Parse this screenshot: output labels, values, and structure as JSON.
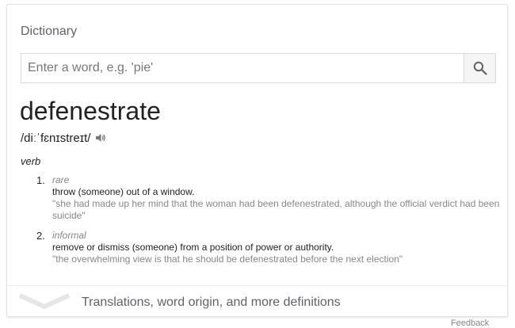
{
  "card": {
    "title": "Dictionary",
    "search": {
      "placeholder": "Enter a word, e.g. 'pie'"
    },
    "entry": {
      "word": "defenestrate",
      "pronunciation": "/diːˈfɛnɪstreɪt/",
      "part_of_speech": "verb",
      "senses": [
        {
          "number": "1.",
          "register": "rare",
          "definition": "throw (someone) out of a window.",
          "example": "\"she had made up her mind that the woman had been defenestrated, although the official verdict had been suicide\""
        },
        {
          "number": "2.",
          "register": "informal",
          "definition": "remove or dismiss (someone) from a position of power or authority.",
          "example": "\"the overwhelming view is that he should be defenestrated before the next election\""
        }
      ]
    },
    "more_link": "Translations, word origin, and more definitions"
  },
  "footer": {
    "feedback": "Feedback"
  },
  "icons": {
    "search": "search-icon",
    "speaker": "speaker-icon",
    "expand": "chevron-down-icon"
  },
  "colors": {
    "muted_text": "#878787",
    "title_text": "#5f6368",
    "border": "#d9d9d9"
  }
}
